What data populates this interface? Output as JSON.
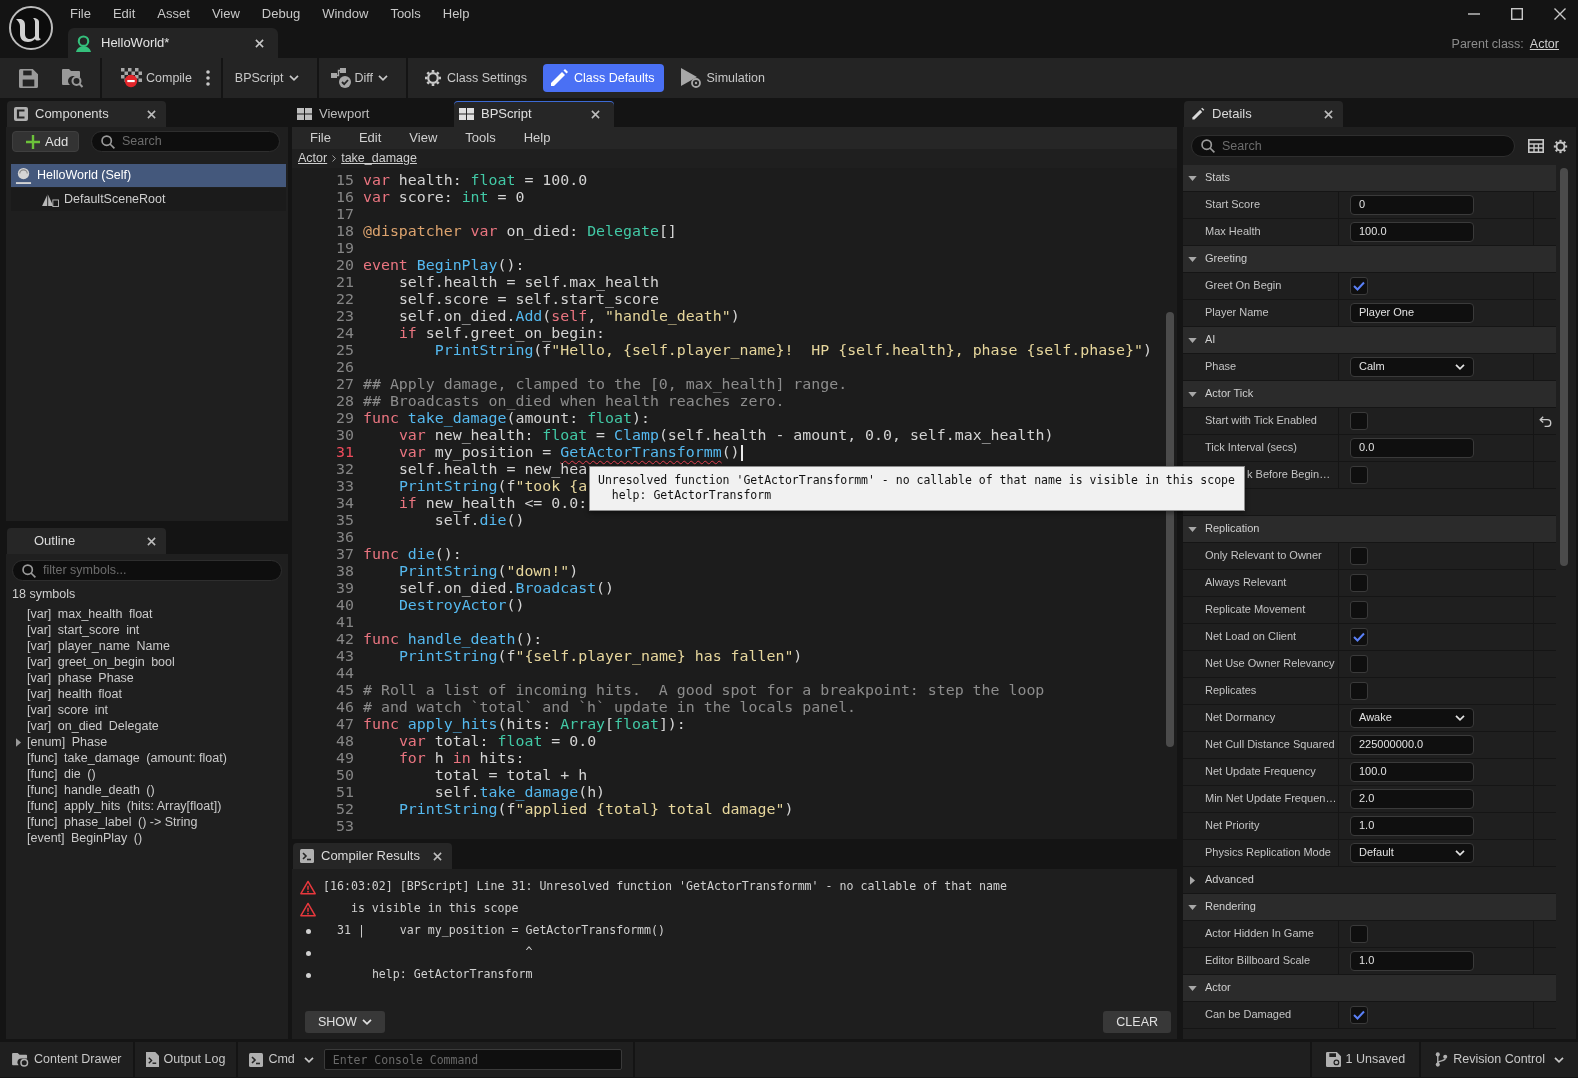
{
  "window": {
    "menu": [
      "File",
      "Edit",
      "Asset",
      "View",
      "Debug",
      "Window",
      "Tools",
      "Help"
    ],
    "document_tab": {
      "title": "HelloWorld*",
      "selected": true
    },
    "parent_class": {
      "label": "Parent class:",
      "value": "Actor"
    }
  },
  "toolbar": [
    {
      "kind": "split",
      "label": "Compile",
      "selected": false
    },
    {
      "kind": "dropdown",
      "label": "BPScript",
      "selected": false
    },
    {
      "kind": "dropdown",
      "label": "Diff",
      "selected": false
    },
    {
      "kind": "toggle",
      "label": "Class Settings",
      "selected": false
    },
    {
      "kind": "toggle",
      "label": "Class Defaults",
      "selected": true
    },
    {
      "kind": "toggle",
      "label": "Simulation",
      "selected": false
    }
  ],
  "components_panel": {
    "title": "Components",
    "add_button": "Add",
    "search": {
      "placeholder": "Search"
    },
    "tree": [
      {
        "label": "HelloWorld (Self)",
        "selected": true,
        "children": [
          {
            "label": "DefaultSceneRoot",
            "selected": false
          }
        ]
      }
    ]
  },
  "outline_panel": {
    "title": "Outline",
    "filter": {
      "placeholder": "filter symbols..."
    },
    "count": "18 symbols",
    "items": [
      {
        "tag": "[var]",
        "name": "max_health",
        "detail": "float"
      },
      {
        "tag": "[var]",
        "name": "start_score",
        "detail": "int"
      },
      {
        "tag": "[var]",
        "name": "player_name",
        "detail": "Name"
      },
      {
        "tag": "[var]",
        "name": "greet_on_begin",
        "detail": "bool"
      },
      {
        "tag": "[var]",
        "name": "phase",
        "detail": "Phase"
      },
      {
        "tag": "[var]",
        "name": "health",
        "detail": "float"
      },
      {
        "tag": "[var]",
        "name": "score",
        "detail": "int"
      },
      {
        "tag": "[var]",
        "name": "on_died",
        "detail": "Delegate"
      },
      {
        "tag": "[enum]",
        "name": "Phase",
        "expanded": false
      },
      {
        "tag": "[func]",
        "name": "take_damage",
        "detail": "(amount: float)"
      },
      {
        "tag": "[func]",
        "name": "die",
        "detail": "()"
      },
      {
        "tag": "[func]",
        "name": "handle_death",
        "detail": "()"
      },
      {
        "tag": "[func]",
        "name": "apply_hits",
        "detail": "(hits: Array[float])"
      },
      {
        "tag": "[func]",
        "name": "phase_label",
        "detail": "() -> String"
      },
      {
        "tag": "[event]",
        "name": "BeginPlay",
        "detail": "()"
      }
    ]
  },
  "editor": {
    "tabs": [
      {
        "label": "Viewport",
        "selected": false
      },
      {
        "label": "BPScript",
        "selected": true
      }
    ],
    "menu": [
      "File",
      "Edit",
      "View",
      "Tools",
      "Help"
    ],
    "breadcrumb": [
      "Actor",
      "take_damage"
    ],
    "lines": [
      {
        "number": "15",
        "error": false,
        "tokens": [
          {
            "kind": "keyword",
            "text": "var"
          },
          {
            "kind": "plain",
            "text": " health: "
          },
          {
            "kind": "type",
            "text": "float"
          },
          {
            "kind": "plain",
            "text": " = 100.0"
          }
        ]
      },
      {
        "number": "16",
        "error": false,
        "tokens": [
          {
            "kind": "keyword",
            "text": "var"
          },
          {
            "kind": "plain",
            "text": " score: "
          },
          {
            "kind": "type",
            "text": "int"
          },
          {
            "kind": "plain",
            "text": " = 0"
          }
        ]
      },
      {
        "number": "17",
        "error": false
      },
      {
        "number": "18",
        "error": false,
        "tokens": [
          {
            "kind": "decorator",
            "text": "@dispatcher "
          },
          {
            "kind": "keyword",
            "text": "var"
          },
          {
            "kind": "plain",
            "text": " on_died: "
          },
          {
            "kind": "type",
            "text": "Delegate"
          },
          {
            "kind": "plain",
            "text": "[]"
          }
        ]
      },
      {
        "number": "19",
        "error": false
      },
      {
        "number": "20",
        "error": false,
        "tokens": [
          {
            "kind": "keyword",
            "text": "event "
          },
          {
            "kind": "function",
            "text": "BeginPlay"
          },
          {
            "kind": "plain",
            "text": "():"
          }
        ]
      },
      {
        "number": "21",
        "error": false,
        "tokens": [
          {
            "kind": "plain",
            "text": "    self.health = self.max_health"
          }
        ]
      },
      {
        "number": "22",
        "error": false,
        "tokens": [
          {
            "kind": "plain",
            "text": "    self.score = self.start_score"
          }
        ]
      },
      {
        "number": "23",
        "error": false,
        "tokens": [
          {
            "kind": "plain",
            "text": "    self.on_died."
          },
          {
            "kind": "function",
            "text": "Add"
          },
          {
            "kind": "plain",
            "text": "("
          },
          {
            "kind": "keyword",
            "text": "self"
          },
          {
            "kind": "plain",
            "text": ", "
          },
          {
            "kind": "string",
            "text": "\"handle_death\""
          },
          {
            "kind": "plain",
            "text": ")"
          }
        ]
      },
      {
        "number": "24",
        "error": false,
        "tokens": [
          {
            "kind": "keyword",
            "text": "    if"
          },
          {
            "kind": "plain",
            "text": " self.greet_on_begin:"
          }
        ]
      },
      {
        "number": "25",
        "error": false,
        "tokens": [
          {
            "kind": "function",
            "text": "        PrintString"
          },
          {
            "kind": "plain",
            "text": "(f"
          },
          {
            "kind": "string",
            "text": "\"Hello, {self.player_name}!  HP {self.health}, phase {self.phase}\""
          },
          {
            "kind": "plain",
            "text": ")"
          }
        ]
      },
      {
        "number": "26",
        "error": false
      },
      {
        "number": "27",
        "error": false,
        "tokens": [
          {
            "kind": "comment",
            "text": "## Apply damage, clamped to the [0, max_health] range."
          }
        ]
      },
      {
        "number": "28",
        "error": false,
        "tokens": [
          {
            "kind": "comment",
            "text": "## Broadcasts on_died when health reaches zero."
          }
        ]
      },
      {
        "number": "29",
        "error": false,
        "tokens": [
          {
            "kind": "keyword",
            "text": "func "
          },
          {
            "kind": "function",
            "text": "take_damage"
          },
          {
            "kind": "plain",
            "text": "(amount: "
          },
          {
            "kind": "type",
            "text": "float"
          },
          {
            "kind": "plain",
            "text": "):"
          }
        ]
      },
      {
        "number": "30",
        "error": false,
        "tokens": [
          {
            "kind": "keyword",
            "text": "    var"
          },
          {
            "kind": "plain",
            "text": " new_health: "
          },
          {
            "kind": "type",
            "text": "float"
          },
          {
            "kind": "plain",
            "text": " = "
          },
          {
            "kind": "function",
            "text": "Clamp"
          },
          {
            "kind": "plain",
            "text": "(self.health - amount, 0.0, self.max_health)"
          }
        ]
      },
      {
        "number": "31",
        "error": true,
        "tokens": [
          {
            "kind": "keyword",
            "text": "    var"
          },
          {
            "kind": "plain",
            "text": " my_position = "
          },
          {
            "kind": "unresolved",
            "text": "GetActorTransformm"
          },
          {
            "kind": "plain",
            "text": "()"
          },
          {
            "kind": "caret"
          }
        ]
      },
      {
        "number": "32",
        "error": false,
        "tokens": [
          {
            "kind": "plain",
            "text": "    self.health = new_hea"
          }
        ]
      },
      {
        "number": "33",
        "error": false,
        "tokens": [
          {
            "kind": "function",
            "text": "    PrintString"
          },
          {
            "kind": "plain",
            "text": "(f"
          },
          {
            "kind": "string",
            "text": "\"took {a"
          }
        ]
      },
      {
        "number": "34",
        "error": false,
        "tokens": [
          {
            "kind": "keyword",
            "text": "    if"
          },
          {
            "kind": "plain",
            "text": " new_health <= 0.0:"
          }
        ]
      },
      {
        "number": "35",
        "error": false,
        "tokens": [
          {
            "kind": "plain",
            "text": "        self."
          },
          {
            "kind": "function",
            "text": "die"
          },
          {
            "kind": "plain",
            "text": "()"
          }
        ]
      },
      {
        "number": "36",
        "error": false
      },
      {
        "number": "37",
        "error": false,
        "tokens": [
          {
            "kind": "keyword",
            "text": "func "
          },
          {
            "kind": "function",
            "text": "die"
          },
          {
            "kind": "plain",
            "text": "():"
          }
        ]
      },
      {
        "number": "38",
        "error": false,
        "tokens": [
          {
            "kind": "function",
            "text": "    PrintString"
          },
          {
            "kind": "plain",
            "text": "("
          },
          {
            "kind": "string",
            "text": "\"down!\""
          },
          {
            "kind": "plain",
            "text": ")"
          }
        ]
      },
      {
        "number": "39",
        "error": false,
        "tokens": [
          {
            "kind": "plain",
            "text": "    self.on_died."
          },
          {
            "kind": "function",
            "text": "Broadcast"
          },
          {
            "kind": "plain",
            "text": "()"
          }
        ]
      },
      {
        "number": "40",
        "error": false,
        "tokens": [
          {
            "kind": "function",
            "text": "    DestroyActor"
          },
          {
            "kind": "plain",
            "text": "()"
          }
        ]
      },
      {
        "number": "41",
        "error": false
      },
      {
        "number": "42",
        "error": false,
        "tokens": [
          {
            "kind": "keyword",
            "text": "func "
          },
          {
            "kind": "function",
            "text": "handle_death"
          },
          {
            "kind": "plain",
            "text": "():"
          }
        ]
      },
      {
        "number": "43",
        "error": false,
        "tokens": [
          {
            "kind": "function",
            "text": "    PrintString"
          },
          {
            "kind": "plain",
            "text": "(f"
          },
          {
            "kind": "string",
            "text": "\"{self.player_name} has fallen\""
          },
          {
            "kind": "plain",
            "text": ")"
          }
        ]
      },
      {
        "number": "44",
        "error": false
      },
      {
        "number": "45",
        "error": false,
        "tokens": [
          {
            "kind": "comment",
            "text": "# Roll a list of incoming hits.  A good spot for a breakpoint: step the loop"
          }
        ]
      },
      {
        "number": "46",
        "error": false,
        "tokens": [
          {
            "kind": "comment",
            "text": "# and watch `total` and `h` update in the locals panel."
          }
        ]
      },
      {
        "number": "47",
        "error": false,
        "tokens": [
          {
            "kind": "keyword",
            "text": "func "
          },
          {
            "kind": "function",
            "text": "apply_hits"
          },
          {
            "kind": "plain",
            "text": "(hits: "
          },
          {
            "kind": "type",
            "text": "Array"
          },
          {
            "kind": "plain",
            "text": "["
          },
          {
            "kind": "type",
            "text": "float"
          },
          {
            "kind": "plain",
            "text": "]):"
          }
        ]
      },
      {
        "number": "48",
        "error": false,
        "tokens": [
          {
            "kind": "keyword",
            "text": "    var"
          },
          {
            "kind": "plain",
            "text": " total: "
          },
          {
            "kind": "type",
            "text": "float"
          },
          {
            "kind": "plain",
            "text": " = 0.0"
          }
        ]
      },
      {
        "number": "49",
        "error": false,
        "tokens": [
          {
            "kind": "keyword",
            "text": "    for"
          },
          {
            "kind": "plain",
            "text": " h "
          },
          {
            "kind": "keyword",
            "text": "in"
          },
          {
            "kind": "plain",
            "text": " hits:"
          }
        ]
      },
      {
        "number": "50",
        "error": false,
        "tokens": [
          {
            "kind": "plain",
            "text": "        total = total + h"
          }
        ]
      },
      {
        "number": "51",
        "error": false,
        "tokens": [
          {
            "kind": "plain",
            "text": "        self."
          },
          {
            "kind": "function",
            "text": "take_damage"
          },
          {
            "kind": "plain",
            "text": "(h)"
          }
        ]
      },
      {
        "number": "52",
        "error": false,
        "tokens": [
          {
            "kind": "function",
            "text": "    PrintString"
          },
          {
            "kind": "plain",
            "text": "(f"
          },
          {
            "kind": "string",
            "text": "\"applied {total} total damage\""
          },
          {
            "kind": "plain",
            "text": ")"
          }
        ]
      },
      {
        "number": "53",
        "error": false
      }
    ],
    "tooltip": {
      "message": "Unresolved function 'GetActorTransformm' - no callable of that name is visible in this scope",
      "help": "help: GetActorTransform"
    }
  },
  "compiler_results": {
    "title": "Compiler Results",
    "messages": [
      {
        "kind": "error",
        "text": "[16:03:02] [BPScript] Line 31: Unresolved function 'GetActorTransformm' - no callable of that name"
      },
      {
        "kind": "error",
        "text": "    is visible in this scope"
      },
      {
        "kind": "note",
        "text": "  31 |     var my_position = GetActorTransformm()"
      },
      {
        "kind": "note",
        "text": "                             ^"
      },
      {
        "kind": "note",
        "text": "       help: GetActorTransform"
      }
    ],
    "show_button": "SHOW",
    "clear_button": "CLEAR"
  },
  "details": {
    "title": "Details",
    "search": {
      "placeholder": "Search"
    },
    "rows": [
      {
        "kind": "category",
        "label": "Stats",
        "expanded": true
      },
      {
        "kind": "text",
        "label": "Start Score",
        "value": "0",
        "modified": false
      },
      {
        "kind": "text",
        "label": "Max Health",
        "value": "100.0",
        "modified": false
      },
      {
        "kind": "category",
        "label": "Greeting",
        "expanded": true
      },
      {
        "kind": "check",
        "label": "Greet On Begin",
        "checked": true,
        "modified": false
      },
      {
        "kind": "text",
        "label": "Player Name",
        "value": "Player One",
        "modified": false
      },
      {
        "kind": "category",
        "label": "AI",
        "expanded": true
      },
      {
        "kind": "combo",
        "label": "Phase",
        "value": "Calm",
        "modified": false
      },
      {
        "kind": "category",
        "label": "Actor Tick",
        "expanded": true
      },
      {
        "kind": "check",
        "label": "Start with Tick Enabled",
        "checked": false,
        "modified": true
      },
      {
        "kind": "text",
        "label": "Tick Interval (secs)",
        "value": "0.0",
        "modified": false
      },
      {
        "kind": "check",
        "label": "k Before Begin…",
        "checked": false,
        "modified": false
      },
      {
        "kind": "blank"
      },
      {
        "kind": "category",
        "label": "Replication",
        "expanded": true
      },
      {
        "kind": "check",
        "label": "Only Relevant to Owner",
        "checked": false,
        "modified": false
      },
      {
        "kind": "check",
        "label": "Always Relevant",
        "checked": false,
        "modified": false
      },
      {
        "kind": "check",
        "label": "Replicate Movement",
        "checked": false,
        "modified": false
      },
      {
        "kind": "check",
        "label": "Net Load on Client",
        "checked": true,
        "modified": false
      },
      {
        "kind": "check",
        "label": "Net Use Owner Relevancy",
        "checked": false,
        "modified": false
      },
      {
        "kind": "check",
        "label": "Replicates",
        "checked": false,
        "modified": false
      },
      {
        "kind": "combo",
        "label": "Net Dormancy",
        "value": "Awake",
        "modified": false
      },
      {
        "kind": "text",
        "label": "Net Cull Distance Squared",
        "value": "225000000.0",
        "modified": false
      },
      {
        "kind": "text",
        "label": "Net Update Frequency",
        "value": "100.0",
        "modified": false
      },
      {
        "kind": "text",
        "label": "Min Net Update Frequen…",
        "value": "2.0",
        "modified": false
      },
      {
        "kind": "text",
        "label": "Net Priority",
        "value": "1.0",
        "modified": false
      },
      {
        "kind": "combo",
        "label": "Physics Replication Mode",
        "value": "Default",
        "modified": false
      },
      {
        "kind": "advanced",
        "label": "Advanced",
        "expanded": false
      },
      {
        "kind": "category",
        "label": "Rendering",
        "expanded": true
      },
      {
        "kind": "check",
        "label": "Actor Hidden In Game",
        "checked": false,
        "modified": false
      },
      {
        "kind": "text",
        "label": "Editor Billboard Scale",
        "value": "1.0",
        "modified": false
      },
      {
        "kind": "category",
        "label": "Actor",
        "expanded": true
      },
      {
        "kind": "check",
        "label": "Can be Damaged",
        "checked": true,
        "modified": false
      }
    ]
  },
  "status_bar": {
    "left": [
      {
        "kind": "button",
        "label": "Content Drawer"
      },
      {
        "kind": "button",
        "label": "Output Log"
      },
      {
        "kind": "dropdown",
        "label": "Cmd"
      }
    ],
    "console": {
      "placeholder": "Enter Console Command"
    },
    "right": [
      {
        "kind": "button",
        "label": "1 Unsaved"
      },
      {
        "kind": "dropdown",
        "label": "Revision Control"
      }
    ]
  }
}
